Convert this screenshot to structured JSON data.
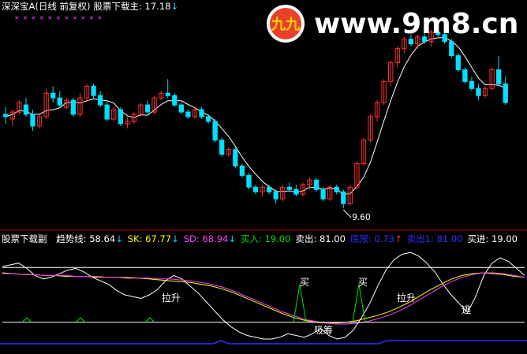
{
  "upper_header": {
    "name": "深深宝A",
    "mode": "(日线 前复权)",
    "indicator": "股票下载主",
    "value": ": 17.18",
    "arrow": "↓"
  },
  "lower_header": {
    "name": "股票下载副",
    "items": [
      {
        "label": "趋势线",
        "value": "58.64",
        "arrow": "↓",
        "label_color": "#ffffff",
        "value_color": "#ffffff"
      },
      {
        "label": "SK",
        "value": "67.77",
        "arrow": "↓",
        "label_color": "#ffff00",
        "value_color": "#ffff00"
      },
      {
        "label": "SD",
        "value": "68.94",
        "arrow": "↓",
        "label_color": "#ff40ff",
        "value_color": "#ff40ff"
      },
      {
        "label": "买入",
        "value": "19.00",
        "arrow": "",
        "label_color": "#00e000",
        "value_color": "#00e000"
      },
      {
        "label": "卖出",
        "value": "81.00",
        "arrow": "",
        "label_color": "#ffffff",
        "value_color": "#ffffff"
      },
      {
        "label": "底限",
        "value": "0.73",
        "arrow": "↑",
        "label_color": "#3030ff",
        "value_color": "#3030ff"
      },
      {
        "label": "卖出1",
        "value": "81.00",
        "arrow": "",
        "label_color": "#3030ff",
        "value_color": "#3030ff"
      },
      {
        "label": "买进",
        "value": "19.00",
        "arrow": "",
        "label_color": "#ffffff",
        "value_color": "#ffffff"
      }
    ]
  },
  "watermark": {
    "text": "www.9m8.cn",
    "badge_text": "九九",
    "colors": {
      "text": "#ffffff",
      "badge": "#e8412a"
    }
  },
  "colors": {
    "up": "#ff3030",
    "down": "#00e0ff",
    "ma": "#ffffff",
    "trend": "#ffffff",
    "sk": "#ffff00",
    "sd": "#ff40ff",
    "buy": "#00e000",
    "floor": "#3030ff"
  },
  "chart_data": [
    {
      "type": "candlestick",
      "ylim": [
        9.0,
        17.8
      ],
      "low_label": "9.60",
      "candles": [
        [
          13.6,
          13.9,
          13.2,
          13.5
        ],
        [
          13.4,
          13.8,
          13.1,
          13.7
        ],
        [
          13.7,
          14.2,
          13.6,
          14.1
        ],
        [
          14.0,
          14.3,
          13.5,
          13.6
        ],
        [
          13.6,
          13.8,
          12.9,
          13.1
        ],
        [
          13.1,
          13.6,
          13.0,
          13.5
        ],
        [
          13.5,
          14.7,
          13.4,
          14.5
        ],
        [
          14.5,
          14.8,
          14.1,
          14.3
        ],
        [
          14.3,
          14.6,
          13.9,
          14.0
        ],
        [
          13.9,
          14.3,
          13.8,
          14.2
        ],
        [
          14.2,
          14.3,
          13.5,
          13.6
        ],
        [
          13.6,
          14.5,
          13.5,
          14.3
        ],
        [
          14.3,
          14.9,
          14.2,
          14.8
        ],
        [
          14.8,
          14.9,
          14.3,
          14.4
        ],
        [
          14.4,
          14.6,
          13.9,
          14.0
        ],
        [
          14.0,
          14.2,
          13.3,
          13.4
        ],
        [
          13.4,
          13.9,
          13.3,
          13.8
        ],
        [
          13.8,
          13.9,
          13.1,
          13.2
        ],
        [
          13.2,
          13.5,
          13.0,
          13.3
        ],
        [
          13.3,
          13.7,
          13.2,
          13.6
        ],
        [
          13.6,
          14.1,
          13.5,
          14.0
        ],
        [
          14.0,
          14.2,
          13.6,
          13.7
        ],
        [
          13.7,
          14.4,
          13.6,
          14.3
        ],
        [
          14.3,
          14.6,
          14.2,
          14.5
        ],
        [
          14.5,
          15.1,
          14.3,
          14.4
        ],
        [
          14.4,
          14.5,
          13.9,
          14.0
        ],
        [
          14.0,
          14.1,
          13.6,
          13.7
        ],
        [
          13.7,
          13.8,
          13.4,
          13.5
        ],
        [
          13.5,
          13.9,
          13.4,
          13.8
        ],
        [
          13.8,
          13.9,
          13.4,
          13.5
        ],
        [
          13.5,
          13.6,
          13.2,
          13.3
        ],
        [
          13.3,
          13.4,
          12.4,
          12.5
        ],
        [
          12.5,
          12.6,
          11.8,
          11.9
        ],
        [
          11.9,
          12.2,
          11.8,
          12.1
        ],
        [
          12.1,
          12.2,
          11.3,
          11.4
        ],
        [
          11.4,
          11.5,
          10.9,
          11.0
        ],
        [
          11.0,
          11.1,
          10.4,
          10.5
        ],
        [
          10.5,
          10.6,
          10.2,
          10.3
        ],
        [
          10.3,
          10.6,
          10.1,
          10.5
        ],
        [
          10.5,
          10.6,
          10.2,
          10.3
        ],
        [
          10.3,
          10.4,
          9.8,
          10.0
        ],
        [
          10.0,
          10.6,
          9.9,
          10.5
        ],
        [
          10.5,
          10.7,
          10.3,
          10.4
        ],
        [
          10.4,
          10.6,
          10.1,
          10.2
        ],
        [
          10.2,
          10.7,
          10.1,
          10.6
        ],
        [
          10.6,
          10.9,
          10.4,
          10.8
        ],
        [
          10.8,
          10.9,
          10.3,
          10.4
        ],
        [
          10.4,
          10.5,
          9.9,
          10.0
        ],
        [
          10.0,
          10.6,
          9.9,
          10.5
        ],
        [
          10.5,
          10.6,
          10.2,
          10.3
        ],
        [
          10.3,
          10.4,
          9.6,
          9.8
        ],
        [
          9.8,
          10.6,
          9.7,
          10.5
        ],
        [
          10.5,
          11.6,
          10.4,
          11.5
        ],
        [
          11.5,
          12.6,
          11.4,
          12.5
        ],
        [
          12.5,
          13.6,
          12.4,
          13.5
        ],
        [
          13.5,
          14.2,
          13.3,
          14.1
        ],
        [
          14.1,
          15.1,
          14.0,
          15.0
        ],
        [
          15.0,
          15.9,
          14.8,
          15.8
        ],
        [
          15.8,
          16.5,
          15.6,
          16.4
        ],
        [
          16.4,
          16.9,
          16.2,
          16.8
        ],
        [
          16.8,
          17.0,
          16.5,
          16.6
        ],
        [
          16.6,
          17.0,
          16.4,
          16.9
        ],
        [
          16.9,
          17.1,
          16.6,
          16.7
        ],
        [
          16.7,
          17.2,
          16.5,
          17.1
        ],
        [
          17.1,
          17.3,
          16.9,
          17.0
        ],
        [
          17.0,
          17.4,
          16.6,
          16.7
        ],
        [
          16.7,
          16.8,
          16.0,
          16.1
        ],
        [
          16.1,
          16.2,
          15.4,
          15.5
        ],
        [
          15.5,
          15.6,
          14.9,
          15.0
        ],
        [
          15.0,
          15.2,
          14.6,
          14.7
        ],
        [
          14.7,
          14.9,
          14.2,
          14.4
        ],
        [
          14.4,
          14.8,
          14.3,
          14.7
        ],
        [
          14.7,
          15.6,
          14.6,
          15.5
        ],
        [
          15.5,
          16.1,
          14.8,
          14.9
        ],
        [
          14.9,
          15.2,
          14.0,
          14.1
        ]
      ]
    },
    {
      "type": "line",
      "ylim": [
        0,
        100
      ],
      "series": [
        {
          "name": "趋势线",
          "values": [
            82,
            84,
            86,
            80,
            72,
            68,
            70,
            74,
            78,
            80,
            76,
            70,
            66,
            62,
            55,
            50,
            48,
            46,
            50,
            56,
            66,
            72,
            68,
            60,
            52,
            42,
            32,
            22,
            14,
            8,
            4,
            2,
            0,
            0,
            2,
            6,
            4,
            2,
            6,
            12,
            4,
            0,
            2,
            10,
            24,
            40,
            60,
            78,
            90,
            96,
            98,
            94,
            86,
            76,
            62,
            50,
            40,
            30,
            48,
            72,
            86,
            92,
            88,
            80,
            72
          ]
        },
        {
          "name": "SK",
          "values": [
            75,
            74,
            73,
            73,
            72,
            72,
            71,
            71,
            71,
            70,
            70,
            70,
            69,
            69,
            68,
            67,
            66,
            65,
            64,
            62,
            60,
            57,
            53,
            48,
            43,
            38,
            33,
            28,
            24,
            21,
            19,
            18,
            18,
            19,
            21,
            24,
            27,
            31,
            36,
            42,
            49,
            56,
            62,
            68,
            72,
            74,
            75,
            74,
            73,
            71,
            70
          ]
        },
        {
          "name": "SD",
          "values": [
            74,
            74,
            73,
            73,
            72,
            72,
            72,
            71,
            71,
            71,
            70,
            70,
            70,
            69,
            69,
            68,
            68,
            67,
            66,
            64,
            62,
            59,
            55,
            50,
            45,
            40,
            35,
            30,
            26,
            22,
            20,
            18,
            17,
            17,
            18,
            20,
            23,
            27,
            32,
            38,
            45,
            52,
            59,
            65,
            70,
            73,
            75,
            75,
            74,
            72,
            70
          ]
        },
        {
          "name": "买入",
          "values": [
            19,
            19,
            19,
            19,
            19,
            19,
            19,
            19,
            19,
            19,
            19,
            19,
            19,
            19,
            19,
            19,
            19,
            19,
            19,
            19,
            19,
            19,
            19,
            19,
            19,
            19,
            19,
            19,
            19,
            19,
            19,
            19,
            19,
            19,
            19,
            19,
            19,
            19,
            19,
            19,
            19,
            19,
            19,
            19,
            19,
            19,
            19,
            19,
            19,
            19,
            19
          ]
        },
        {
          "name": "卖出",
          "values": [
            81,
            81,
            81,
            81,
            81,
            81,
            81,
            81,
            81,
            81,
            81,
            81,
            81,
            81,
            81,
            81,
            81,
            81,
            81,
            81,
            81,
            81,
            81,
            81,
            81,
            81,
            81,
            81,
            81,
            81,
            81,
            81,
            81,
            81,
            81,
            81,
            81,
            81,
            81,
            81,
            81,
            81,
            81,
            81,
            81,
            81,
            81,
            81,
            81,
            81,
            81
          ]
        }
      ],
      "annotations": [
        "拉升",
        "买",
        "吸筹",
        "买",
        "拉升",
        "逃"
      ]
    }
  ]
}
